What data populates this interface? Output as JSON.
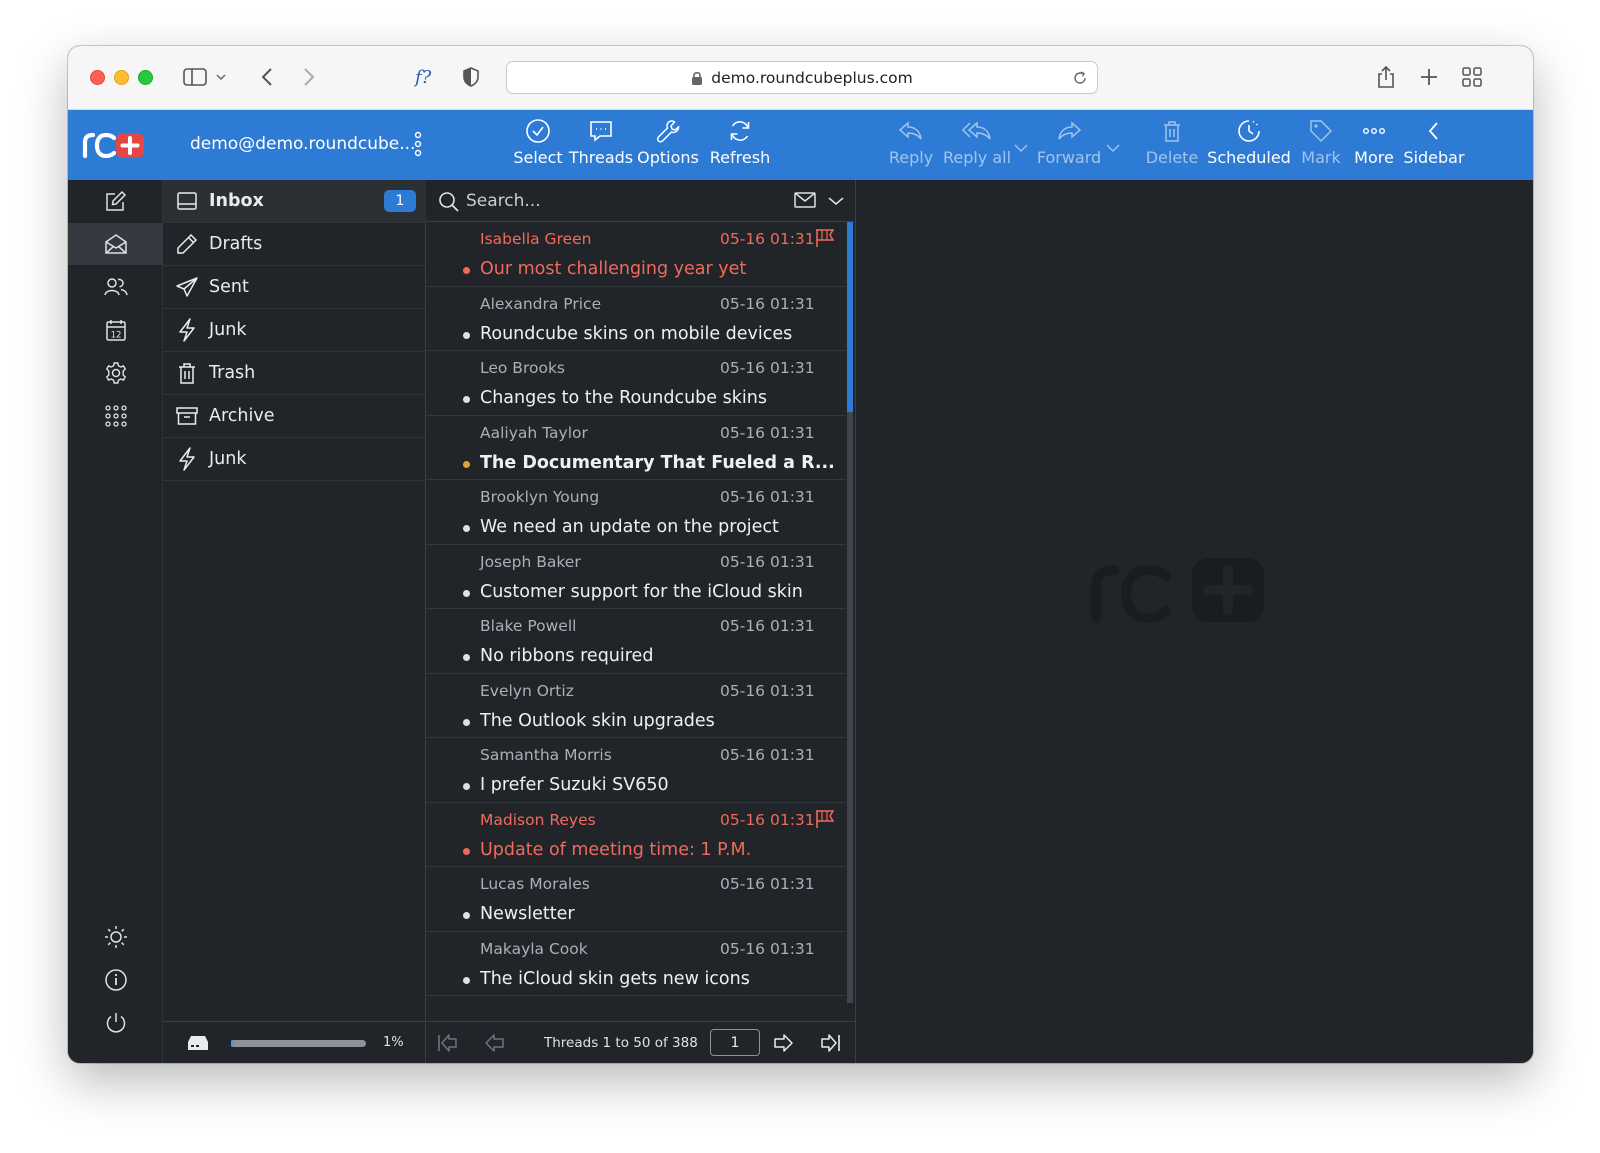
{
  "browser": {
    "url": "demo.roundcubeplus.com"
  },
  "app": {
    "account": "demo@demo.roundcube...",
    "toolbar": {
      "select": "Select",
      "threads": "Threads",
      "options": "Options",
      "refresh": "Refresh",
      "reply": "Reply",
      "reply_all": "Reply all",
      "forward": "Forward",
      "delete": "Delete",
      "scheduled": "Scheduled",
      "mark": "Mark",
      "more": "More",
      "sidebar": "Sidebar"
    }
  },
  "folders": [
    {
      "label": "Inbox",
      "badge": "1"
    },
    {
      "label": "Drafts"
    },
    {
      "label": "Sent"
    },
    {
      "label": "Junk"
    },
    {
      "label": "Trash"
    },
    {
      "label": "Archive"
    },
    {
      "label": "Junk"
    }
  ],
  "quota": {
    "percent_text": "1%",
    "fraction": 0.01
  },
  "search": {
    "placeholder": "Search..."
  },
  "messages": [
    {
      "from": "Isabella Green",
      "date": "05-16 01:31",
      "subject": "Our most challenging year yet"
    },
    {
      "from": "Alexandra Price",
      "date": "05-16 01:31",
      "subject": "Roundcube skins on mobile devices"
    },
    {
      "from": "Leo Brooks",
      "date": "05-16 01:31",
      "subject": "Changes to the Roundcube skins"
    },
    {
      "from": "Aaliyah Taylor",
      "date": "05-16 01:31",
      "subject": "The Documentary That Fueled a R..."
    },
    {
      "from": "Brooklyn Young",
      "date": "05-16 01:31",
      "subject": "We need an update on the project"
    },
    {
      "from": "Joseph Baker",
      "date": "05-16 01:31",
      "subject": "Customer support for the iCloud skin"
    },
    {
      "from": "Blake Powell",
      "date": "05-16 01:31",
      "subject": "No ribbons required"
    },
    {
      "from": "Evelyn Ortiz",
      "date": "05-16 01:31",
      "subject": "The Outlook skin upgrades"
    },
    {
      "from": "Samantha Morris",
      "date": "05-16 01:31",
      "subject": "I prefer Suzuki SV650"
    },
    {
      "from": "Madison Reyes",
      "date": "05-16 01:31",
      "subject": "Update of meeting time: 1 P.M."
    },
    {
      "from": "Lucas Morales",
      "date": "05-16 01:31",
      "subject": "Newsletter"
    },
    {
      "from": "Makayla Cook",
      "date": "05-16 01:31",
      "subject": "The iCloud skin gets new icons"
    }
  ],
  "pager": {
    "text": "Threads 1 to 50 of 388",
    "page": "1"
  },
  "colors": {
    "accent": "#2e7bd6",
    "flagged": "#f06a5a",
    "unread_dot": "#e0a43a",
    "background": "#212529"
  }
}
